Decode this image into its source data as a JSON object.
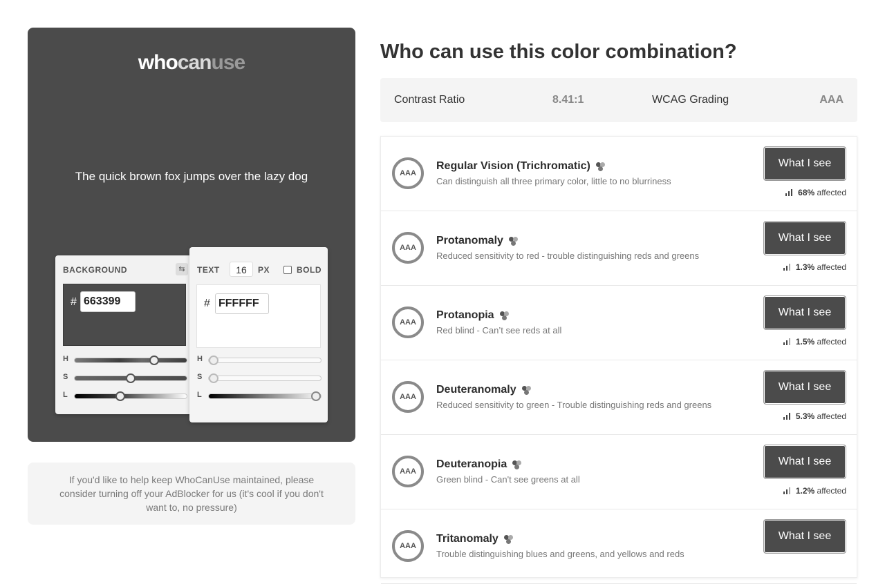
{
  "logo": {
    "part1": "who",
    "part2": "can",
    "part3": "use"
  },
  "preview": {
    "sample_text": "The quick brown fox jumps over the lazy dog"
  },
  "background_card": {
    "label": "BACKGROUND",
    "hash": "#",
    "hex": "663399",
    "sliders": [
      {
        "label": "H",
        "value": 0.73
      },
      {
        "label": "S",
        "value": 0.5
      },
      {
        "label": "L",
        "value": 0.4
      }
    ]
  },
  "text_card": {
    "label": "TEXT",
    "size": "16",
    "unit": "PX",
    "bold_label": "BOLD",
    "bold_checked": false,
    "hash": "#",
    "hex": "FFFFFF",
    "sliders": [
      {
        "label": "H",
        "value": 0.0
      },
      {
        "label": "S",
        "value": 0.0
      },
      {
        "label": "L",
        "value": 1.0
      }
    ]
  },
  "ad_message": "If you'd like to help keep WhoCanUse maintained, please consider turning off your AdBlocker for us (it's cool if you don't want to, no pressure)",
  "title": "Who can use this color combination?",
  "stats": {
    "contrast_label": "Contrast Ratio",
    "contrast_value": "8.41:1",
    "grading_label": "WCAG Grading",
    "grading_value": "AAA"
  },
  "button_label": "What I see",
  "affected_suffix": "affected",
  "visions": [
    {
      "grade": "AAA",
      "name": "Regular Vision (Trichromatic)",
      "desc": "Can distinguish all three primary color, little to no blurriness",
      "pct": "68%"
    },
    {
      "grade": "AAA",
      "name": "Protanomaly",
      "desc": "Reduced sensitivity to red - trouble distinguishing reds and greens",
      "pct": "1.3%"
    },
    {
      "grade": "AAA",
      "name": "Protanopia",
      "desc": "Red blind - Can’t see reds at all",
      "pct": "1.5%"
    },
    {
      "grade": "AAA",
      "name": "Deuteranomaly",
      "desc": "Reduced sensitivity to green - Trouble distinguishing reds and greens",
      "pct": "5.3%"
    },
    {
      "grade": "AAA",
      "name": "Deuteranopia",
      "desc": "Green blind - Can't see greens at all",
      "pct": "1.2%"
    },
    {
      "grade": "AAA",
      "name": "Tritanomaly",
      "desc": "Trouble distinguishing blues and greens, and yellows and reds",
      "pct": ""
    }
  ]
}
